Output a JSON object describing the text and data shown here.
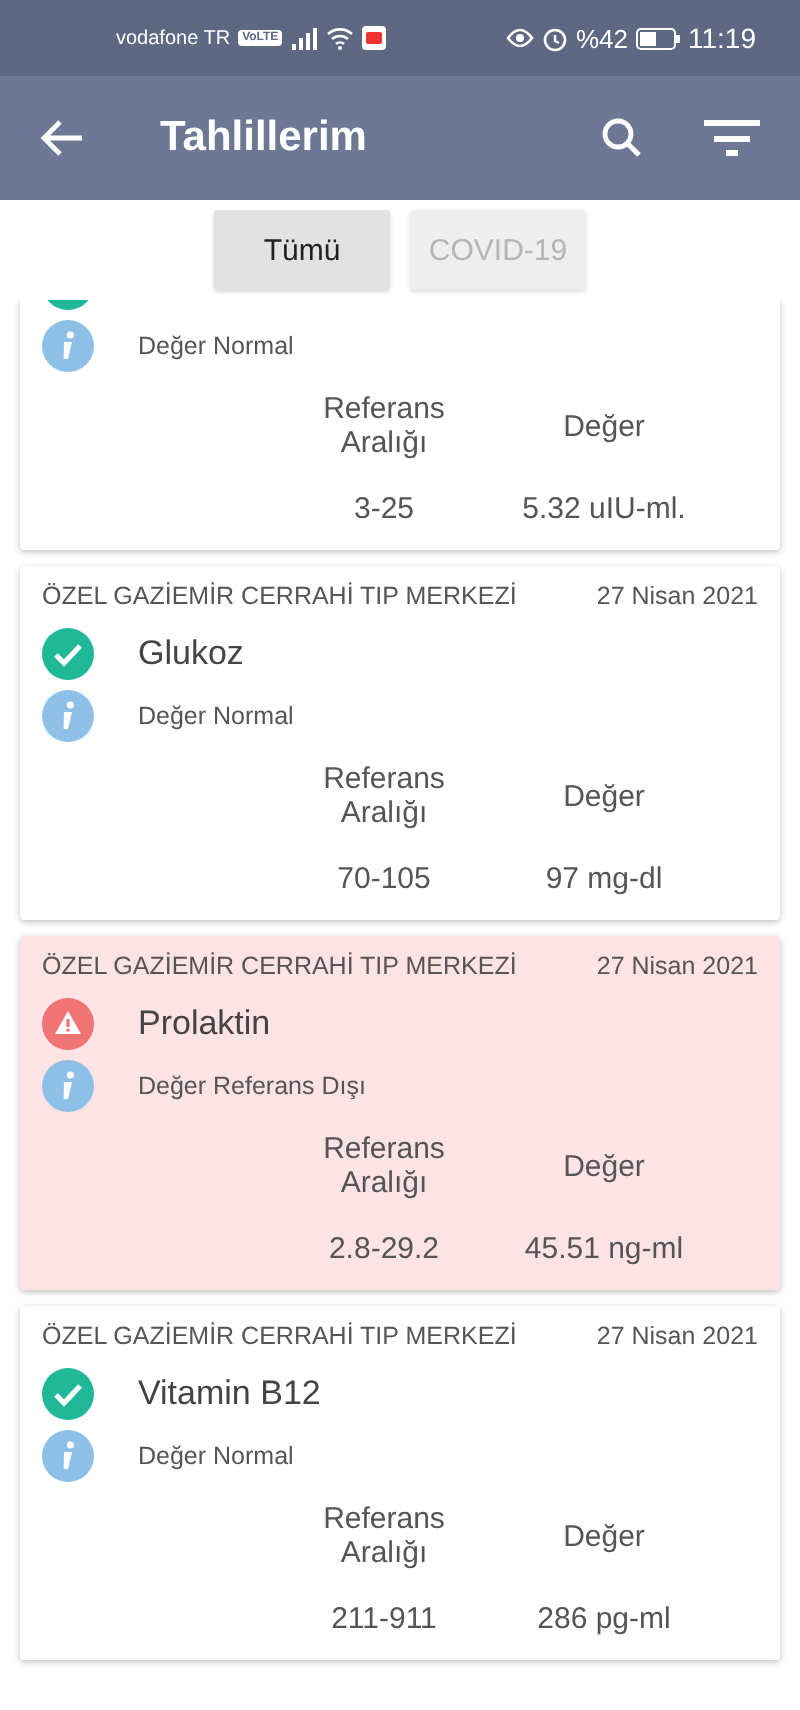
{
  "status_bar": {
    "carrier": "vodafone TR",
    "volte": "VoLTE",
    "battery_text": "%42",
    "time": "11:19"
  },
  "app_bar": {
    "title": "Tahlillerim"
  },
  "tabs": [
    {
      "label": "Tümü",
      "selected": true
    },
    {
      "label": "COVID-19",
      "selected": false
    }
  ],
  "results": [
    {
      "out_of_range": false,
      "note": "Değer Normal",
      "ref_label": "Referans Aralığı",
      "value_label": "Değer",
      "ref": "3-25",
      "value": "5.32 uIU-ml."
    },
    {
      "hospital": "ÖZEL GAZİEMİR CERRAHİ TIP MERKEZİ",
      "date": "27 Nisan 2021",
      "name": "Glukoz",
      "out_of_range": false,
      "note": "Değer Normal",
      "ref_label": "Referans Aralığı",
      "value_label": "Değer",
      "ref": "70-105",
      "value": "97 mg-dl"
    },
    {
      "hospital": "ÖZEL GAZİEMİR CERRAHİ TIP MERKEZİ",
      "date": "27 Nisan 2021",
      "name": "Prolaktin",
      "out_of_range": true,
      "note": "Değer Referans Dışı",
      "ref_label": "Referans Aralığı",
      "value_label": "Değer",
      "ref": "2.8-29.2",
      "value": "45.51 ng-ml"
    },
    {
      "hospital": "ÖZEL GAZİEMİR CERRAHİ TIP MERKEZİ",
      "date": "27 Nisan 2021",
      "name": "Vitamin B12",
      "out_of_range": false,
      "note": "Değer Normal",
      "ref_label": "Referans Aralığı",
      "value_label": "Değer",
      "ref": "211-911",
      "value": "286 pg-ml"
    }
  ]
}
